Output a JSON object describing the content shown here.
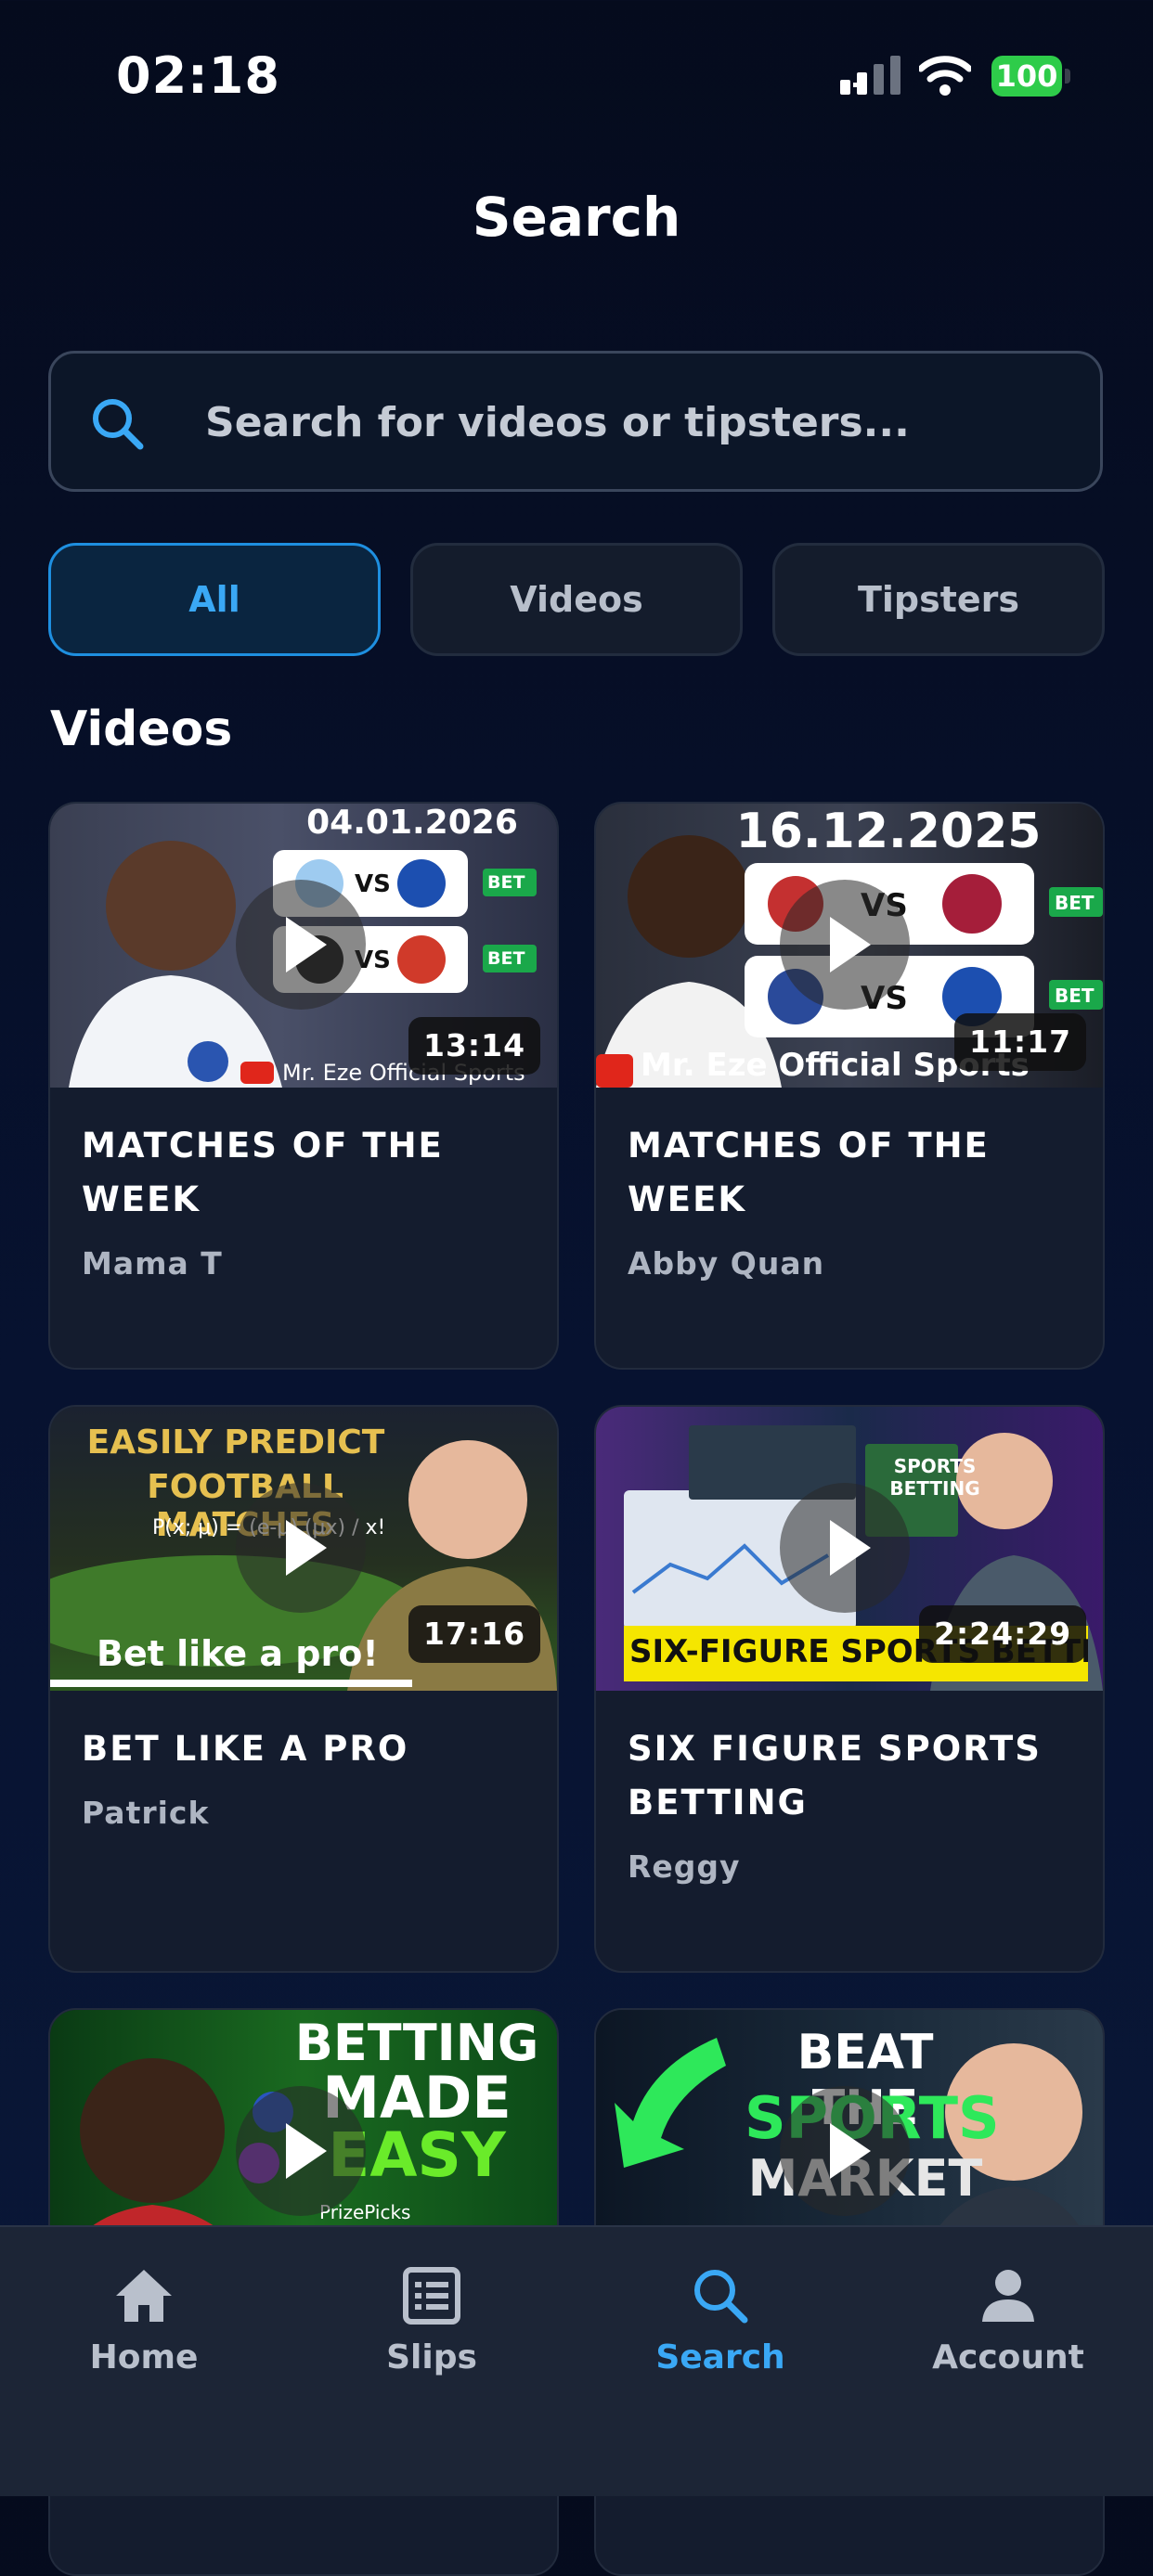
{
  "status_bar": {
    "time": "02:18",
    "battery": "100"
  },
  "header": {
    "title": "Search"
  },
  "search": {
    "placeholder": "Search for videos or tipsters..."
  },
  "filters": [
    {
      "label": "All",
      "active": true
    },
    {
      "label": "Videos",
      "active": false
    },
    {
      "label": "Tipsters",
      "active": false
    }
  ],
  "section": {
    "title": "Videos"
  },
  "videos": [
    {
      "title": "MATCHES  OF THE WEEK",
      "author": "Mama T",
      "duration": "13:14",
      "thumb_text": {
        "date": "04.01.2026",
        "vs": "VS",
        "bet": "BET",
        "channel": "Mr. Eze Official Sports"
      }
    },
    {
      "title": "MATCHES OF THE WEEK",
      "author": "Abby Quan",
      "duration": "11:17",
      "thumb_text": {
        "date": "16.12.2025",
        "vs": "VS",
        "bet": "BET",
        "channel": "Mr. Eze Official Sports"
      }
    },
    {
      "title": "BET LIKE A PRO",
      "author": "Patrick",
      "duration": "17:16",
      "thumb_text": {
        "line1": "EASILY PREDICT",
        "line2": "FOOTBALL MATCHES",
        "formula": "P(x; μ) = (e-μ) (μx) / x!",
        "tagline": "Bet like a pro!"
      }
    },
    {
      "title": "SIX FIGURE SPORTS BETTING",
      "author": "Reggy",
      "duration": "2:24:29",
      "thumb_text": {
        "banner": "SIX-FIGURE SPORTS BETTING",
        "sign": "SPORTS BETTING"
      }
    },
    {
      "title": "",
      "author": "",
      "duration": "",
      "thumb_text": {
        "line1": "BETTING",
        "line2": "MADE",
        "line3": "EASY",
        "brand": "PrizePicks"
      }
    },
    {
      "title": "",
      "author": "",
      "duration": "",
      "thumb_text": {
        "line1": "BEAT THE",
        "line2": "SPORTS",
        "line3": "MARKET"
      }
    }
  ],
  "bottom_nav": [
    {
      "label": "Home",
      "icon": "home-icon"
    },
    {
      "label": "Slips",
      "icon": "list-icon"
    },
    {
      "label": "Search",
      "icon": "search-icon",
      "active": true
    },
    {
      "label": "Account",
      "icon": "account-icon"
    }
  ],
  "colors": {
    "accent": "#3aa8f5",
    "background": "#071230",
    "card": "#141c2e",
    "bet_green": "#1aa84a"
  }
}
